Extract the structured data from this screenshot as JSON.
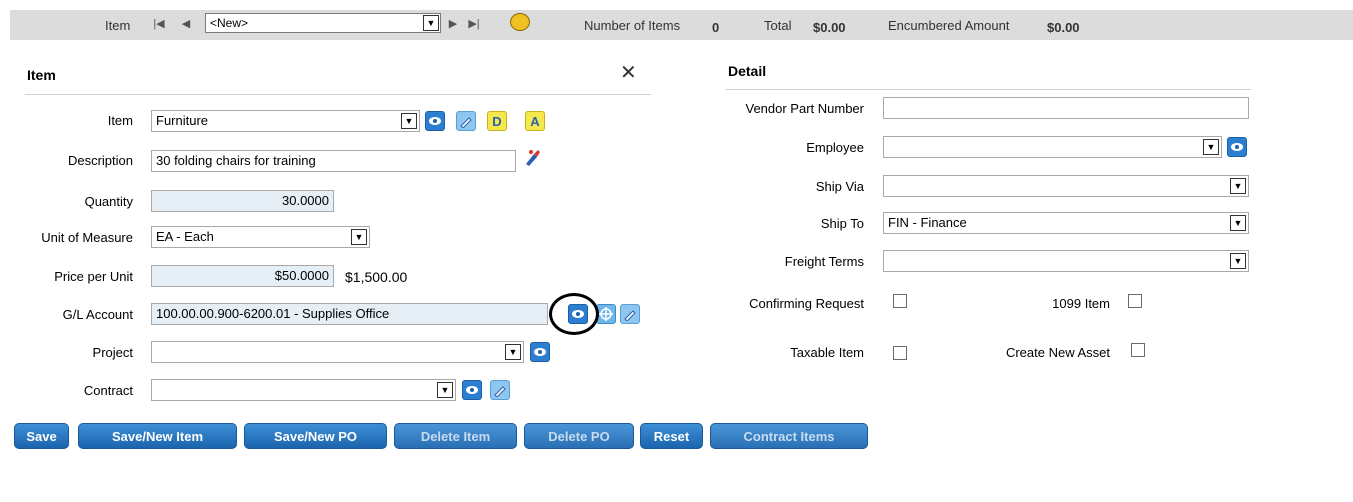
{
  "toolbar": {
    "item_label": "Item",
    "item_select_value": "<New>",
    "num_items_label": "Number of Items",
    "num_items_value": "0",
    "total_label": "Total",
    "total_value": "$0.00",
    "encumbered_label": "Encumbered Amount",
    "encumbered_value": "$0.00"
  },
  "item_section": {
    "title": "Item",
    "item_label": "Item",
    "item_value": "Furniture",
    "description_label": "Description",
    "description_value": "30 folding chairs for training",
    "quantity_label": "Quantity",
    "quantity_value": "30.0000",
    "uom_label": "Unit of Measure",
    "uom_value": "EA - Each",
    "price_label": "Price per Unit",
    "price_value": "$50.0000",
    "extended_total": "$1,500.00",
    "gl_label": "G/L Account",
    "gl_value": "100.00.00.900-6200.01 - Supplies Office",
    "project_label": "Project",
    "project_value": "",
    "contract_label": "Contract",
    "contract_value": "",
    "letter_d": "D",
    "letter_a": "A"
  },
  "detail_section": {
    "title": "Detail",
    "vendor_part_label": "Vendor Part Number",
    "vendor_part_value": "",
    "employee_label": "Employee",
    "employee_value": "",
    "ship_via_label": "Ship Via",
    "ship_via_value": "",
    "ship_to_label": "Ship To",
    "ship_to_value": "FIN - Finance",
    "freight_label": "Freight Terms",
    "freight_value": "",
    "confirming_label": "Confirming Request",
    "item1099_label": "1099 Item",
    "taxable_label": "Taxable Item",
    "new_asset_label": "Create New Asset"
  },
  "buttons": {
    "save": "Save",
    "save_new_item": "Save/New Item",
    "save_new_po": "Save/New PO",
    "delete_item": "Delete Item",
    "delete_po": "Delete PO",
    "reset": "Reset",
    "contract_items": "Contract Items"
  },
  "colors": {
    "button_blue": "#1b64ae",
    "readonly_field": "#e6eef6",
    "toolbar_bg": "#dcdcdc"
  }
}
